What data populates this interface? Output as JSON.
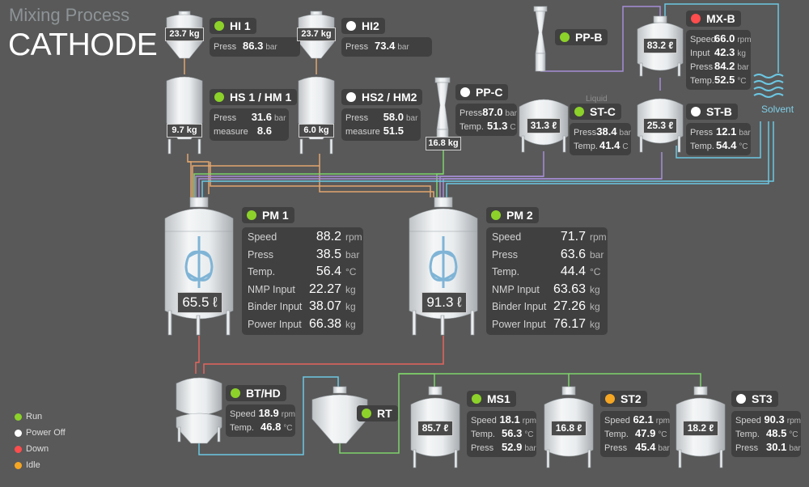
{
  "header": {
    "title": "Mixing Process",
    "subtitle": "CATHODE"
  },
  "colors": {
    "run": "#8cd22a",
    "power_off": "#ffffff",
    "down": "#ff4d4d",
    "idle": "#f5a623",
    "pipe_orange": "#e1a66f",
    "pipe_blue": "#6cc7e3",
    "pipe_purple": "#a58ed6",
    "pipe_green": "#7ed26b",
    "pipe_red": "#e5645c",
    "pipe_teal": "#4fb0b8"
  },
  "legend": [
    {
      "label": "Run",
      "color": "#8cd22a"
    },
    {
      "label": "Power Off",
      "color": "#ffffff"
    },
    {
      "label": "Down",
      "color": "#ff4d4d"
    },
    {
      "label": "Idle",
      "color": "#f5a623"
    }
  ],
  "units": [
    {
      "name": "HI 1",
      "status_color": "#8cd22a",
      "volume": "23.7 kg",
      "rows": [
        {
          "label": "Press",
          "value": "86.3",
          "unit": "bar"
        }
      ]
    },
    {
      "name": "HI2",
      "status_color": "#ffffff",
      "volume": "23.7 kg",
      "rows": [
        {
          "label": "Press",
          "value": "73.4",
          "unit": "bar"
        }
      ]
    },
    {
      "name": "HS 1 / HM 1",
      "status_color": "#8cd22a",
      "volume": "9.7 kg",
      "rows": [
        {
          "label": "Press",
          "value": "31.6",
          "unit": "bar"
        },
        {
          "label": "measure",
          "value": "8.6",
          "unit": ""
        }
      ]
    },
    {
      "name": "HS2 / HM2",
      "status_color": "#ffffff",
      "volume": "6.0 kg",
      "rows": [
        {
          "label": "Press",
          "value": "58.0",
          "unit": "bar"
        },
        {
          "label": "measure",
          "value": "51.5",
          "unit": ""
        }
      ]
    },
    {
      "name": "PP-B",
      "status_color": "#8cd22a",
      "volume": "",
      "rows": []
    },
    {
      "name": "PP-C",
      "status_color": "#ffffff",
      "volume": "16.8 kg",
      "rows": [
        {
          "label": "Press",
          "value": "87.0",
          "unit": "bar"
        },
        {
          "label": "Temp.",
          "value": "51.3",
          "unit": "C"
        }
      ]
    },
    {
      "name": "ST-C",
      "status_color": "#8cd22a",
      "volume": "31.3 ℓ",
      "rows": [
        {
          "label": "Press",
          "value": "38.4",
          "unit": "bar"
        },
        {
          "label": "Temp.",
          "value": "41.4",
          "unit": "C"
        }
      ]
    },
    {
      "name": "MX-B",
      "status_color": "#ff4d4d",
      "volume": "83.2 ℓ",
      "rows": [
        {
          "label": "Speed",
          "value": "66.0",
          "unit": "rpm"
        },
        {
          "label": "Input",
          "value": "42.3",
          "unit": "kg"
        },
        {
          "label": "Press",
          "value": "84.2",
          "unit": "bar"
        },
        {
          "label": "Temp.",
          "value": "52.5",
          "unit": "°C"
        }
      ]
    },
    {
      "name": "ST-B",
      "status_color": "#ffffff",
      "volume": "25.3 ℓ",
      "rows": [
        {
          "label": "Press",
          "value": "12.1",
          "unit": "bar"
        },
        {
          "label": "Temp.",
          "value": "54.4",
          "unit": "°C"
        }
      ]
    },
    {
      "name": "PM 1",
      "status_color": "#8cd22a",
      "volume": "65.5 ℓ",
      "rows": [
        {
          "label": "Speed",
          "value": "88.2",
          "unit": "rpm"
        },
        {
          "label": "Press",
          "value": "38.5",
          "unit": "bar"
        },
        {
          "label": "Temp.",
          "value": "56.4",
          "unit": "°C"
        },
        {
          "label": "NMP Input",
          "value": "22.27",
          "unit": "kg"
        },
        {
          "label": "Binder Input",
          "value": "38.07",
          "unit": "kg"
        },
        {
          "label": "Power Input",
          "value": "66.38",
          "unit": "kg"
        }
      ]
    },
    {
      "name": "PM 2",
      "status_color": "#8cd22a",
      "volume": "91.3 ℓ",
      "rows": [
        {
          "label": "Speed",
          "value": "71.7",
          "unit": "rpm"
        },
        {
          "label": "Press",
          "value": "63.6",
          "unit": "bar"
        },
        {
          "label": "Temp.",
          "value": "44.4",
          "unit": "°C"
        },
        {
          "label": "NMP Input",
          "value": "63.63",
          "unit": "kg"
        },
        {
          "label": "Binder Input",
          "value": "27.26",
          "unit": "kg"
        },
        {
          "label": "Power Input",
          "value": "76.17",
          "unit": "kg"
        }
      ]
    },
    {
      "name": "BT/HD",
      "status_color": "#8cd22a",
      "volume": "",
      "rows": [
        {
          "label": "Speed",
          "value": "18.9",
          "unit": "rpm"
        },
        {
          "label": "Temp.",
          "value": "46.8",
          "unit": "°C"
        }
      ]
    },
    {
      "name": "RT",
      "status_color": "#8cd22a",
      "volume": "",
      "rows": []
    },
    {
      "name": "MS1",
      "status_color": "#8cd22a",
      "volume": "85.7 ℓ",
      "rows": [
        {
          "label": "Speed",
          "value": "18.1",
          "unit": "rpm"
        },
        {
          "label": "Temp.",
          "value": "56.3",
          "unit": "°C"
        },
        {
          "label": "Press",
          "value": "52.9",
          "unit": "bar"
        }
      ]
    },
    {
      "name": "ST2",
      "status_color": "#f5a623",
      "volume": "16.8 ℓ",
      "rows": [
        {
          "label": "Speed",
          "value": "62.1",
          "unit": "rpm"
        },
        {
          "label": "Temp.",
          "value": "47.9",
          "unit": "°C"
        },
        {
          "label": "Press",
          "value": "45.4",
          "unit": "bar"
        }
      ]
    },
    {
      "name": "ST3",
      "status_color": "#ffffff",
      "volume": "18.2 ℓ",
      "rows": [
        {
          "label": "Speed",
          "value": "90.3",
          "unit": "rpm"
        },
        {
          "label": "Temp.",
          "value": "48.5",
          "unit": "°C"
        },
        {
          "label": "Press",
          "value": "30.1",
          "unit": "bar"
        }
      ]
    }
  ],
  "labels": {
    "solvent": "Solvent",
    "liquid": "Liquid"
  },
  "icons": {
    "solvent": "waves-icon",
    "vessel": "tank-icon",
    "pump": "pump-icon"
  }
}
